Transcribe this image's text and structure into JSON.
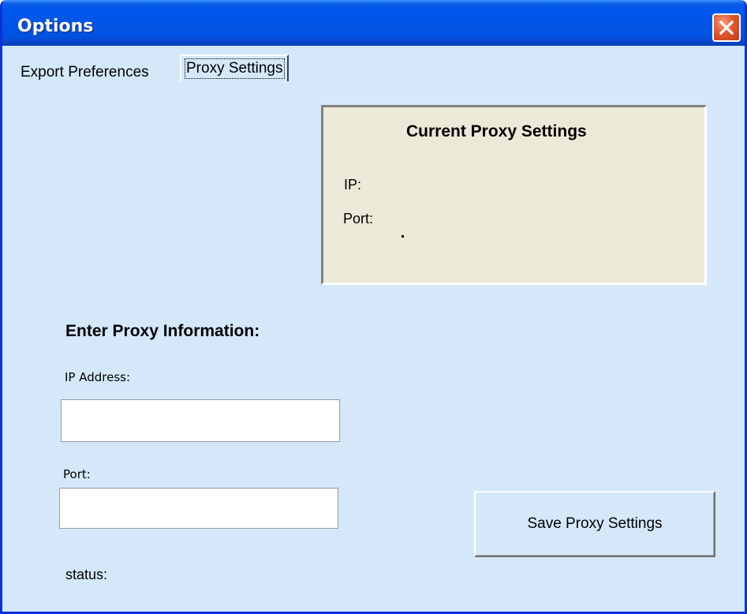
{
  "window": {
    "title": "Options",
    "close_icon": "close-icon"
  },
  "tabs": [
    {
      "label": "Export Preferences",
      "selected": false
    },
    {
      "label": "Proxy Settings",
      "selected": true
    }
  ],
  "current_settings": {
    "title": "Current Proxy Settings",
    "ip_label": "IP:",
    "ip_value": "",
    "port_label": "Port:",
    "port_value": ""
  },
  "form": {
    "heading": "Enter Proxy Information:",
    "ip_label": "IP Address:",
    "ip_value": "",
    "port_label": "Port:",
    "port_value": "",
    "save_label": "Save Proxy Settings",
    "status_label": "status:"
  },
  "colors": {
    "titlebar": "#0058ee",
    "client_bg": "#d4e8fa",
    "group_bg": "#ece9d8",
    "close_button": "#e2572e"
  }
}
